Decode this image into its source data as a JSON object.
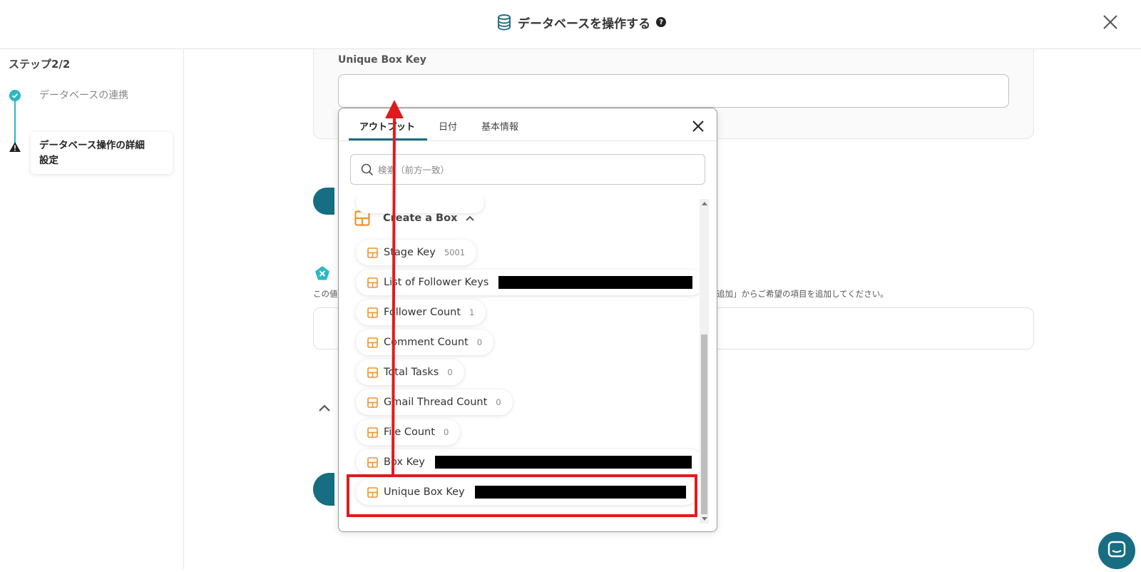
{
  "header": {
    "title": "データベースを操作する",
    "help_glyph": "?",
    "icons": {
      "db": "database-icon",
      "help": "help-circle-icon",
      "close": "close-icon"
    }
  },
  "sidebar": {
    "step_label": "ステップ2/2",
    "steps": [
      {
        "label": "データベースの連携",
        "status": "done"
      },
      {
        "label_line1": "データベース操作の詳細",
        "label_line2": "設定",
        "status": "warning"
      }
    ]
  },
  "main": {
    "field_label": "Unique Box Key",
    "field_value": "",
    "bg_text_left": "この値",
    "bg_text_right": "追加」からご希望の項目を追加してください。"
  },
  "popup": {
    "tabs": [
      {
        "label": "アウトプット",
        "active": true
      },
      {
        "label": "日付",
        "active": false
      },
      {
        "label": "基本情報",
        "active": false
      }
    ],
    "search_placeholder": "検索（前方一致）",
    "group": {
      "label": "Create a Box",
      "expanded": true
    },
    "items": [
      {
        "label": "Stage Key",
        "value": "5001",
        "redacted": false
      },
      {
        "label": "List of Follower Keys",
        "value": "",
        "redacted": true
      },
      {
        "label": "Follower Count",
        "value": "1",
        "redacted": false
      },
      {
        "label": "Comment Count",
        "value": "0",
        "redacted": false
      },
      {
        "label": "Total Tasks",
        "value": "0",
        "redacted": false
      },
      {
        "label": "Gmail Thread Count",
        "value": "0",
        "redacted": false
      },
      {
        "label": "File Count",
        "value": "0",
        "redacted": false
      },
      {
        "label": "Box Key",
        "value": "",
        "redacted": true
      },
      {
        "label": "Unique Box Key",
        "value": "",
        "redacted": true
      }
    ]
  },
  "colors": {
    "accent": "#176e82",
    "teal": "#2bb7c4",
    "orange": "#f0932b",
    "highlight": "#e01b1b"
  }
}
